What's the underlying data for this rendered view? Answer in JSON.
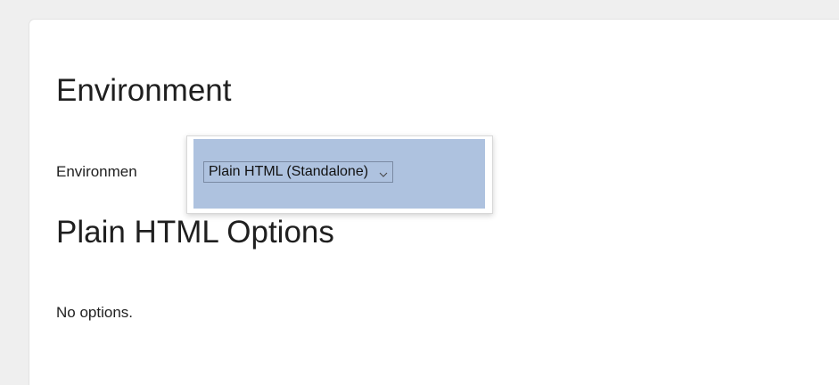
{
  "environment_section": {
    "heading": "Environment",
    "field_label": "Environmen",
    "select": {
      "value": "Plain HTML (Standalone)",
      "icon": "chevron-down-icon"
    }
  },
  "options_section": {
    "heading": "Plain HTML Options",
    "message": "No options."
  },
  "colors": {
    "page_background": "#efefef",
    "panel_background": "#ffffff",
    "selection_highlight": "#aec2df"
  }
}
